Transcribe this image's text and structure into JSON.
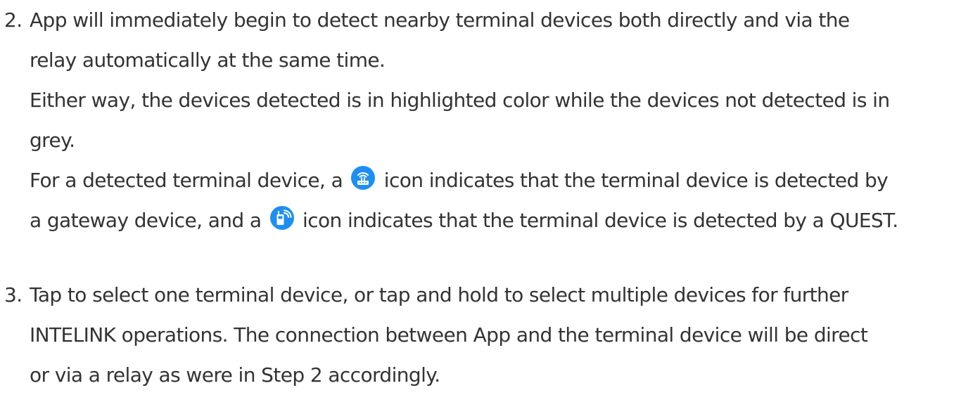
{
  "steps": [
    {
      "number": "2.",
      "lines": [
        "App will immediately begin to detect nearby terminal devices both directly and via the",
        "relay automatically at the same time.",
        "Either way, the devices detected is in highlighted color while the devices not detected is in",
        "grey."
      ],
      "icon_line_1": {
        "before": "For a detected terminal device, a",
        "icon": "gateway-icon",
        "after": "icon indicates that the terminal device is detected by"
      },
      "icon_line_2": {
        "before": "a gateway device, and a",
        "icon": "quest-icon",
        "after": "icon indicates that the terminal device is detected by a QUEST."
      }
    },
    {
      "number": "3.",
      "lines": [
        "Tap to select one terminal device, or tap and hold to select multiple devices for further",
        "INTELINK operations. The connection between App and the terminal device will be direct",
        "or via a relay as were in Step 2 accordingly."
      ]
    }
  ],
  "colors": {
    "text": "#333333",
    "icon_blue": "#1e8ff2"
  }
}
